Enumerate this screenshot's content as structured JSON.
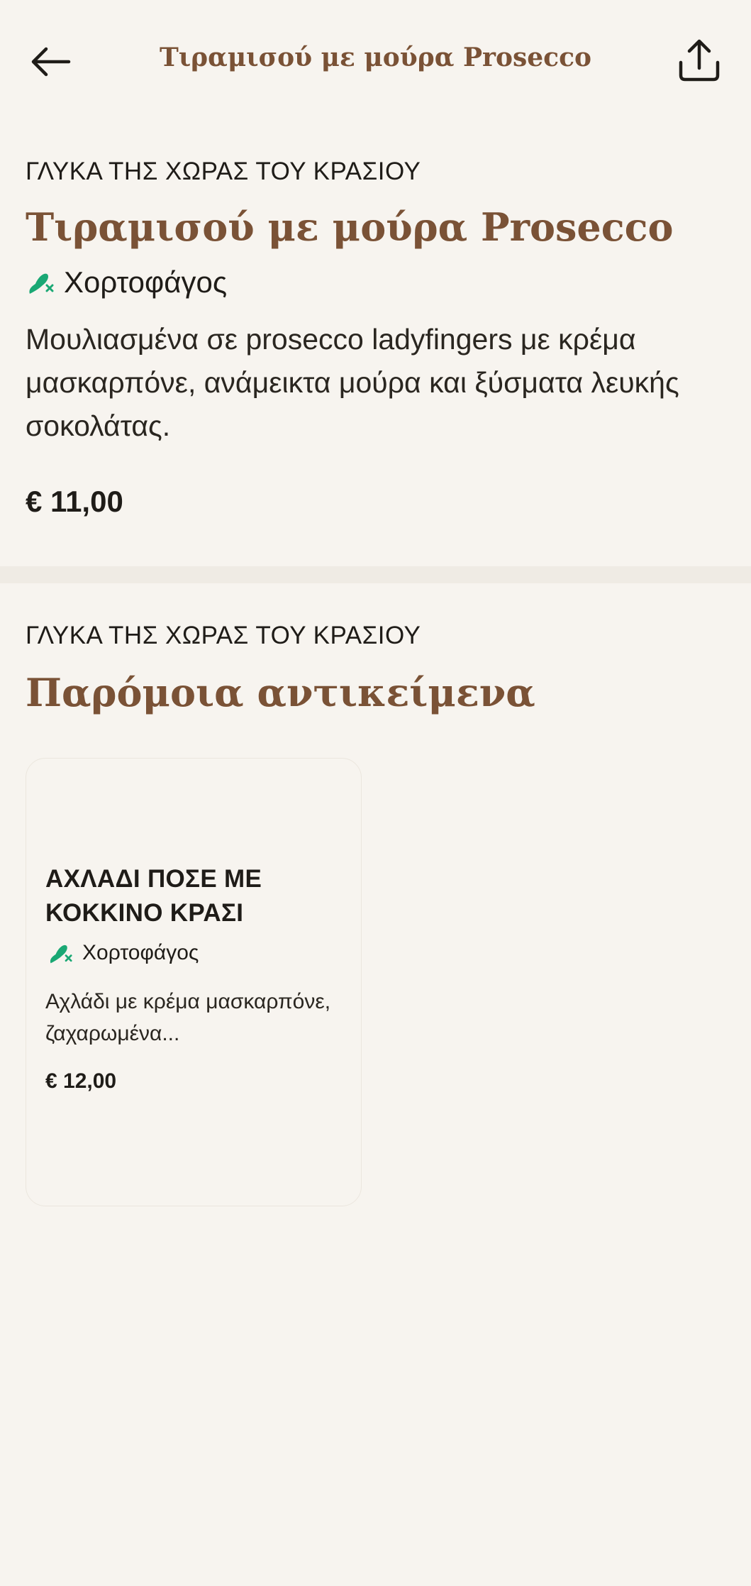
{
  "header": {
    "title": "Τιραμισού με μούρα Prosecco",
    "back_icon": "arrow-left-icon",
    "share_icon": "share-icon"
  },
  "product": {
    "category": "ΓΛΥΚΑ ΤΗΣ ΧΩΡΑΣ ΤΟΥ ΚΡΑΣΙΟΥ",
    "title": "Τιραμισού με μούρα Prosecco",
    "diet_label": "Χορτοφάγος",
    "diet_icon": "vegetarian-icon",
    "description": "Μουλιασμένα σε prosecco ladyfingers με κρέμα μασκαρπόνε, ανάμεικτα μούρα και ξύσματα λευκής σοκολάτας.",
    "price": "€ 11,00"
  },
  "similar": {
    "category": "ΓΛΥΚΑ ΤΗΣ ΧΩΡΑΣ ΤΟΥ ΚΡΑΣΙΟΥ",
    "title": "Παρόμοια αντικείμενα",
    "items": [
      {
        "title": "ΑΧΛΑΔΙ ΠΟΣΕ ΜΕ ΚΟΚΚΙΝΟ ΚΡΑΣΙ",
        "diet_label": "Χορτοφάγος",
        "description": "Αχλάδι με κρέμα μασκαρπόνε, ζαχαρωμένα...",
        "price": "€ 12,00"
      }
    ]
  },
  "colors": {
    "background": "#f7f4ef",
    "accent_brown": "#7a5236",
    "veg_green": "#1aa874"
  }
}
